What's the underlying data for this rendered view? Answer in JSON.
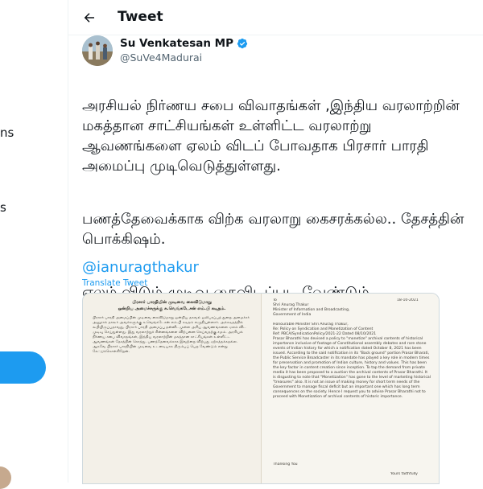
{
  "left_nav": {
    "fragment_1": "ns",
    "fragment_2": "s"
  },
  "header": {
    "title": "Tweet"
  },
  "author": {
    "name": "Su Venkatesan MP",
    "handle": "@SuVe4Madurai"
  },
  "tweet": {
    "paragraphs": [
      "அரசியல் நிர்ணய சபை விவாதங்கள் ,இந்திய வரலாற்றின் மகத்தான சாட்சியங்கள் உள்ளிட்ட வரலாற்று ஆவணங்களை ஏலம் விடப் போவதாக பிரசார் பாரதி அமைப்பு முடிவெடுத்துள்ளது.",
      "பணத்தேவைக்காக விற்க வரலாறு கைசரக்கல்ல.. தேசத்தின் பொக்கிஷம்.",
      "ஏலம் விடும் முடிவு கைவிடப்பட வேண்டும்."
    ],
    "mention": "@ianuragthakur",
    "translate_label": "Translate Tweet"
  },
  "media": {
    "left_doc": {
      "heading": "பிரசார் பாரதியின் முடிவை கைவிடுமாறு",
      "subheading": "ஒன்றிய அமைச்சருக்கு சு.வெங்கடேசன் எம்.பி கடிதம்.",
      "body": "பிரசார் பாரதி அமைப்பின் முடிவை கைவிடுமாறு ஒன்றிய தகவல் ஒலிபரப்புத் துறை அமைச்சர் அனுராக் தாகூர் அவர்களுக்கு சு.வெங்கடேசன் எம்.பி கடிதம் எழுதியுள்ளார். அக்கடிதத்தில் கூறியிருப்பதாவது, பிரசார் பாரதி அமைப்பு தன்னிடமுள்ள அரிய ஆவணங்களை ஏலம் விட முடிவு செய்துள்ளது. இது வரலாற்றுச் சின்னங்களை விற்பனை செய்வதற்கு சமம். அரசியல் நிர்ணய சபை விவாதங்கள், இந்திய வரலாற்றின் மகத்தான சாட்சியங்கள் உள்ளிட்ட ஆவணங்கள் தேசத்தின் சொத்து. பணத்தேவைக்காக இவற்றை விற்பது ஏற்கத்தக்கதல்ல. ஆகவே பிரசார் பாரதியின் முடிவை உடனடியாக திரும்பப் பெற வேண்டும் என்று கேட்டுக்கொள்கிறேன்."
    },
    "right_doc": {
      "to_lines": "To\nShri Anurag Thakur\nMinister of Information and Broadcasting,\nGovernment of India",
      "date": "18-10-2021",
      "body": "Honourable Minister Shri Anurag Thakur,\nRe: Policy on Syndication and Monetization of Content\nRef: PBCA/SyndicationPolicy/2021-22 Dated 08/10/2021\nPrasar Bharathi has devised a policy to \"monetize\" archival contents of historical importance inclusive of footage of Constitutional assembly debates and rare stone events of Indian history for which a notification dated October 8, 2021 has been issued. According to the said notification in its \"Back ground\" portion Prasar Bharati, the Public Service Broadcaster in its mandate has played a key role in modern times for preservation and promotion of Indian culture, history and values. This has been the key factor in content creation since inception. To tap the demand from private media it has been proposed to a auction the archival contents of Prasar Bharathi. It is disgusting to note that \"Monetization\" has gone to the level of marketing historical \"treasures\" also. It is not an issue of making money for short term needs of the Government to manage fiscal deficit but an important one which has long term consequences on the society. Hence I request you to advise Prasar Bharathi not to proceed with Monetization of archival contents of historic importance.",
      "sign_off": "Thanking You",
      "closing": "Yours faithfully"
    }
  },
  "colors": {
    "accent": "#1d9bf0",
    "text": "#0f1419",
    "muted": "#536471",
    "border": "#eff3f4"
  }
}
